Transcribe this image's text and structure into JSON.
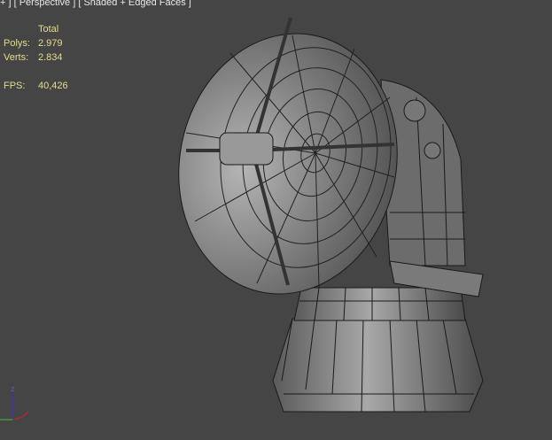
{
  "viewport": {
    "label": "+ ] [ Perspective ] [ Shaded + Edged Faces ]"
  },
  "stats": {
    "header": "Total",
    "polys_label": "Polys:",
    "polys_value": "2.979",
    "verts_label": "Verts:",
    "verts_value": "2.834",
    "fps_label": "FPS:",
    "fps_value": "40,426"
  },
  "gizmo": {
    "axis_z": "z"
  },
  "colors": {
    "background": "#454545",
    "stats_text": "#e6dc8c",
    "mesh": "#8a8a8a",
    "wire": "#1a1a1a"
  }
}
